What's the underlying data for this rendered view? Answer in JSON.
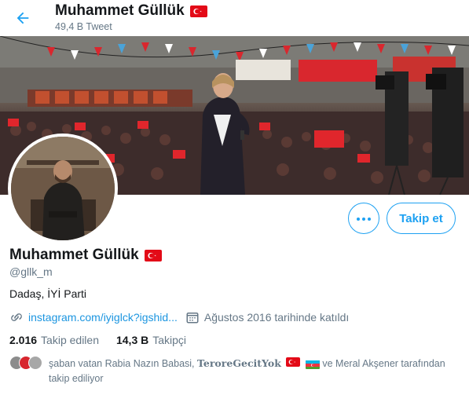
{
  "header": {
    "name": "Muhammet Güllük",
    "tweet_count": "49,4 B Tweet"
  },
  "profile": {
    "name": "Muhammet Güllük",
    "handle": "@gllk_m",
    "bio": "Dadaş, İYİ Parti",
    "link": "instagram.com/iyiglck?igshid...",
    "joined": "Ağustos 2016 tarihinde katıldı"
  },
  "actions": {
    "follow_label": "Takip et"
  },
  "stats": {
    "following_count": "2.016",
    "following_label": "Takip edilen",
    "followers_count": "14,3 B",
    "followers_label": "Takipçi"
  },
  "followed_by": {
    "part1": "şaban vatan Rabia Nazın Babasi,",
    "name2": "TeroreGecitYok",
    "part3": "ve Meral Akşener tarafından takip ediliyor"
  },
  "icons": {
    "back": "arrow-left-icon",
    "more": "more-horizontal-icon",
    "link": "link-icon",
    "calendar": "calendar-icon",
    "flag": "turkey-flag-icon",
    "flag_az": "azerbaijan-flag-icon"
  },
  "colors": {
    "accent": "#1da1f2",
    "link": "#1b95e0",
    "secondary_text": "#657786",
    "flag_red": "#e30a17"
  }
}
